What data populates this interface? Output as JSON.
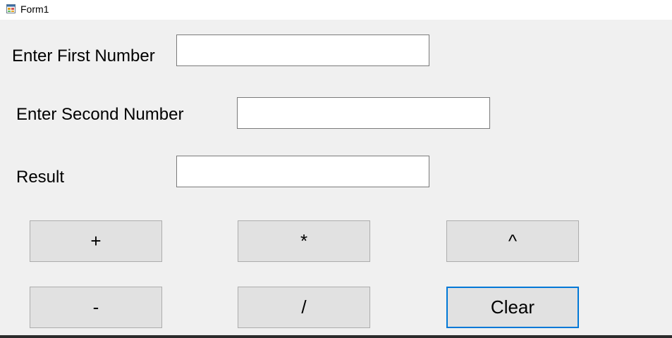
{
  "window": {
    "title": "Form1",
    "icon": "winforms-app-icon"
  },
  "form": {
    "first_number": {
      "label": "Enter First Number",
      "value": ""
    },
    "second_number": {
      "label": "Enter Second Number",
      "value": ""
    },
    "result": {
      "label": "Result",
      "value": ""
    }
  },
  "buttons": {
    "add": "+",
    "multiply": "*",
    "power": "^",
    "subtract": "-",
    "divide": "/",
    "clear": "Clear"
  },
  "colors": {
    "form_background": "#f0f0f0",
    "button_face": "#e1e1e1",
    "button_border": "#adadad",
    "focus_border": "#0078d7"
  }
}
